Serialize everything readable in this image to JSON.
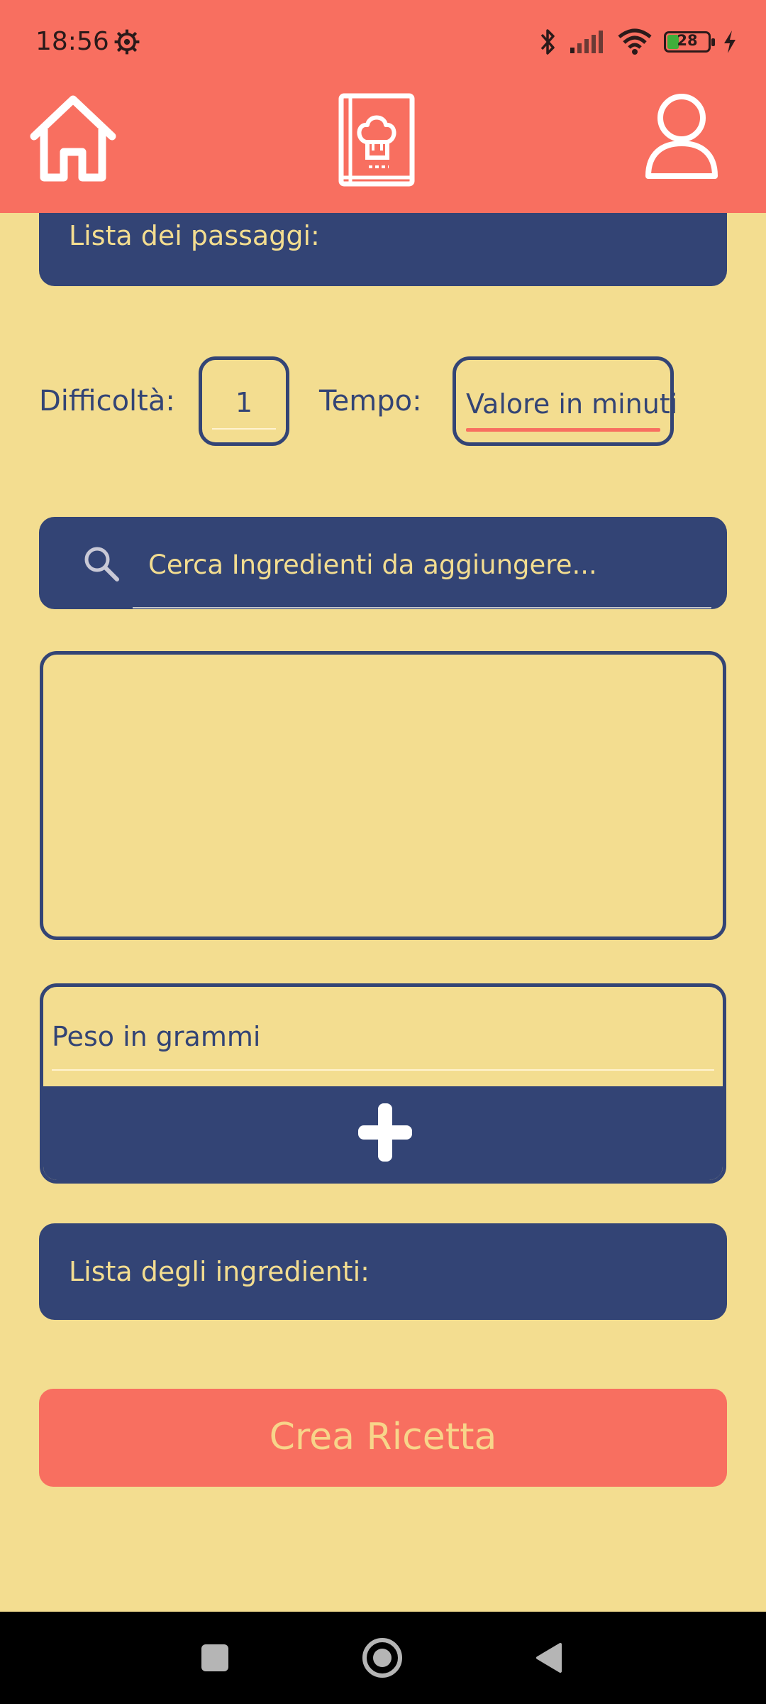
{
  "status_bar": {
    "time": "18:56",
    "battery_level": "28",
    "battery_fraction": 0.28
  },
  "nav": {
    "icons": [
      "home-icon",
      "recipe-book-icon",
      "user-icon"
    ]
  },
  "steps_panel": {
    "label": "Lista dei passaggi:"
  },
  "difficulty": {
    "label": "Difficoltà:",
    "value": "1"
  },
  "time": {
    "label": "Tempo:",
    "placeholder": "Valore in minuti"
  },
  "search": {
    "placeholder": "Cerca Ingredienti da aggiungere..."
  },
  "add_ingredient": {
    "weight_placeholder": "Peso in grammi"
  },
  "ingredients_panel": {
    "label": "Lista degli ingredienti:"
  },
  "create_button": {
    "label": "Crea Ricetta"
  },
  "colors": {
    "header": "#f86f60",
    "background": "#f3dd90",
    "navy": "#334475",
    "accent_text": "#f7d58a"
  }
}
